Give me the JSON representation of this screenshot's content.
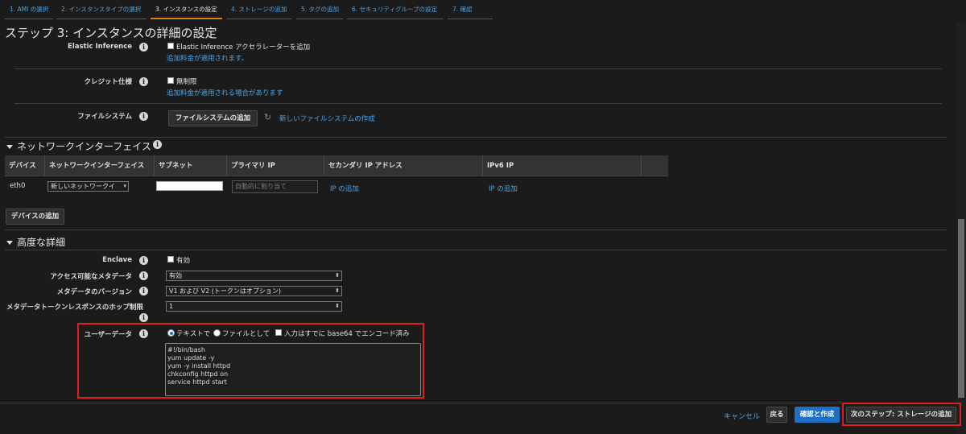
{
  "wizard_tabs": [
    {
      "label": "1. AMI の選択"
    },
    {
      "label": "2. インスタンスタイプの選択"
    },
    {
      "label": "3. インスタンスの設定"
    },
    {
      "label": "4. ストレージの追加"
    },
    {
      "label": "5. タグの追加"
    },
    {
      "label": "6. セキュリティグループの設定"
    },
    {
      "label": "7. 確認"
    }
  ],
  "page_title": "ステップ 3: インスタンスの詳細の設定",
  "info_glyph": "i",
  "elastic_inference": {
    "label": "Elastic Inference",
    "checkbox_label": "Elastic Inference アクセラレーターを追加",
    "note": "追加料金が適用されます。"
  },
  "credit": {
    "label": "クレジット仕様",
    "checkbox_label": "無制限",
    "note": "追加料金が適用される場合があります"
  },
  "filesystem": {
    "label": "ファイルシステム",
    "add_button": "ファイルシステムの追加",
    "create_link": "新しいファイルシステムの作成"
  },
  "network_section": {
    "title": "ネットワークインターフェイス",
    "columns": [
      "デバイス",
      "ネットワークインターフェイス",
      "サブネット",
      "プライマリ IP",
      "セカンダリ IP アドレス",
      "IPv6 IP"
    ],
    "row": {
      "device": "eth0",
      "interface_select": "新しいネットワークイ",
      "primary_ip_placeholder": "自動的に割り当て",
      "secondary_ip_link": "IP の追加",
      "ipv6_link": "IP の追加"
    },
    "add_device_button": "デバイスの追加"
  },
  "advanced_section": {
    "title": "高度な詳細",
    "enclave": {
      "label": "Enclave",
      "checkbox_label": "有効"
    },
    "metadata_access": {
      "label": "アクセス可能なメタデータ",
      "value": "有効"
    },
    "metadata_version": {
      "label": "メタデータのバージョン",
      "value": "V1 および V2 (トークンはオプション)"
    },
    "hop_limit": {
      "label": "メタデータトークンレスポンスのホップ制限",
      "value": "1"
    },
    "user_data": {
      "label": "ユーザーデータ",
      "radio_text": "テキストで",
      "radio_file": "ファイルとして",
      "base64_label": "入力はすでに base64 でエンコード済み",
      "selected": "text",
      "content": "#!/bin/bash\nyum update -y\nyum -y install httpd\nchkconfig httpd on\nservice httpd start"
    }
  },
  "footer": {
    "cancel": "キャンセル",
    "back": "戻る",
    "review_launch": "確認と作成",
    "next": "次のステップ: ストレージの追加"
  },
  "colors": {
    "accent": "#1f6fc4",
    "link": "#4ea5e6",
    "active_tab": "#d87f1b",
    "highlight": "#e31b23"
  }
}
